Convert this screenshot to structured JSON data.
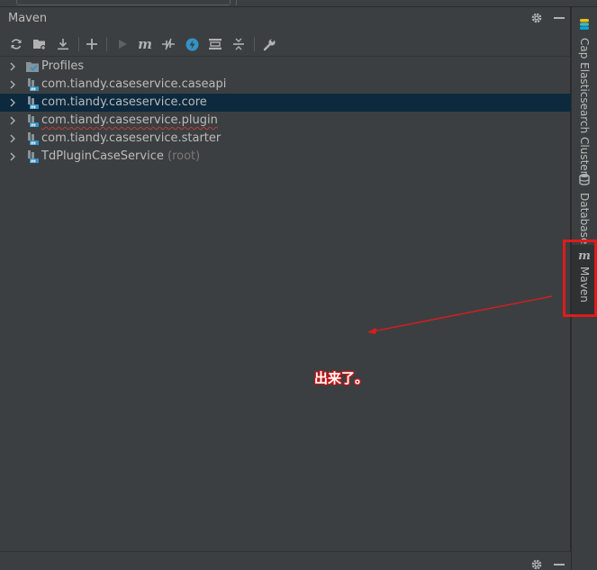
{
  "panel": {
    "title": "Maven"
  },
  "header_icons": [
    "gear-icon",
    "minimize-icon"
  ],
  "toolbar": {
    "buttons": [
      {
        "name": "reload-all-icon",
        "tooltip": ""
      },
      {
        "name": "add-folder-icon",
        "tooltip": ""
      },
      {
        "name": "download-icon",
        "tooltip": ""
      },
      {
        "name": "add-icon",
        "tooltip": ""
      },
      {
        "name": "run-icon",
        "tooltip": ""
      },
      {
        "name": "execute-maven-goal-icon",
        "tooltip": ""
      },
      {
        "name": "toggle-offline-icon",
        "tooltip": ""
      },
      {
        "name": "skip-tests-icon",
        "tooltip": ""
      },
      {
        "name": "show-dependencies-icon",
        "tooltip": ""
      },
      {
        "name": "collapse-all-icon",
        "tooltip": ""
      },
      {
        "name": "settings-wrench-icon",
        "tooltip": ""
      }
    ]
  },
  "tree": {
    "items": [
      {
        "label": "Profiles",
        "suffix": "",
        "icon": "profiles-icon",
        "selected": false,
        "squiggle": false
      },
      {
        "label": "com.tiandy.caseservice.caseapi",
        "suffix": "",
        "icon": "maven-module-icon",
        "selected": false,
        "squiggle": false
      },
      {
        "label": "com.tiandy.caseservice.core",
        "suffix": "",
        "icon": "maven-module-icon",
        "selected": true,
        "squiggle": false
      },
      {
        "label": "com.tiandy.caseservice.plugin",
        "suffix": "",
        "icon": "maven-module-icon",
        "selected": false,
        "squiggle": true
      },
      {
        "label": "com.tiandy.caseservice.starter",
        "suffix": "",
        "icon": "maven-module-icon",
        "selected": false,
        "squiggle": false
      },
      {
        "label": "TdPluginCaseService",
        "suffix": "(root)",
        "icon": "maven-module-icon",
        "selected": false,
        "squiggle": false
      }
    ]
  },
  "side_tabs": [
    {
      "label": "Cap Elasticsearch Cluster",
      "icon": "elasticsearch-icon",
      "active": false
    },
    {
      "label": "Database",
      "icon": "database-icon",
      "active": false
    },
    {
      "label": "Maven",
      "icon": "maven-icon",
      "active": true
    }
  ],
  "annotation": {
    "text": "出来了。",
    "color": "#e01b1b"
  },
  "colors": {
    "panel_bg": "#3c3f41",
    "selection_bg": "#0d293e",
    "text": "#bbbbbb",
    "muted_text": "#787878",
    "accent_blue": "#3592c4",
    "annotation_red": "#e01b1b"
  }
}
